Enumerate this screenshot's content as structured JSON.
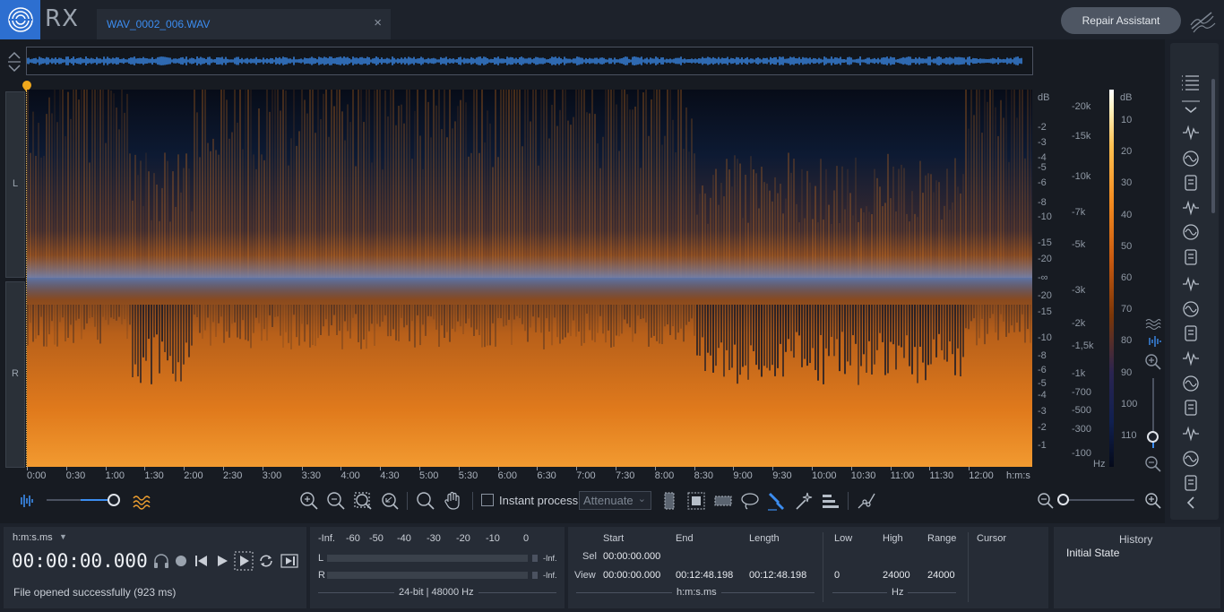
{
  "app": {
    "name": "RX"
  },
  "tab": {
    "file_name": "WAV_0002_006.WAV",
    "close_glyph": "×"
  },
  "header": {
    "repair_assistant_label": "Repair Assistant"
  },
  "channels": {
    "left_label": "L",
    "right_label": "R"
  },
  "db_axis": {
    "unit": "dB",
    "left_ticks": [
      "-2",
      "-3",
      "-4",
      "-5",
      "-6",
      "-8",
      "-10",
      "-15",
      "-20",
      "-∞",
      "-20",
      "-15",
      "-10",
      "-8",
      "-6",
      "-5",
      "-4",
      "-3",
      "-2",
      "-1"
    ],
    "hz_ticks": [
      "-20k",
      "-15k",
      "-10k",
      "-7k",
      "-5k",
      "-3k",
      "-2k",
      "-1,5k",
      "-1k",
      "-700",
      "-500",
      "-300",
      "-100"
    ],
    "hz_unit": "Hz",
    "colorbar_unit": "dB",
    "colorbar_ticks": [
      "10",
      "20",
      "30",
      "40",
      "50",
      "60",
      "70",
      "80",
      "90",
      "100",
      "110"
    ]
  },
  "time_axis": {
    "ticks": [
      "0:00",
      "0:30",
      "1:00",
      "1:30",
      "2:00",
      "2:30",
      "3:00",
      "3:30",
      "4:00",
      "4:30",
      "5:00",
      "5:30",
      "6:00",
      "6:30",
      "7:00",
      "7:30",
      "8:00",
      "8:30",
      "9:00",
      "9:30",
      "10:00",
      "10:30",
      "11:00",
      "11:30",
      "12:00"
    ],
    "unit": "h:m:s"
  },
  "toolbar": {
    "instant_process_label": "Instant process",
    "instant_process_checked": false,
    "mode_select_value": "Attenuate"
  },
  "transport": {
    "time_format_label": "h:m:s.ms",
    "time_display": "00:00:00.000",
    "status_message": "File opened successfully (923 ms)"
  },
  "meter": {
    "scale": [
      "-Inf.",
      "-60",
      "-50",
      "-40",
      "-30",
      "-20",
      "-10",
      "0"
    ],
    "left_label": "L",
    "right_label": "R",
    "left_value": "-Inf.",
    "right_value": "-Inf.",
    "format": "24-bit | 48000 Hz"
  },
  "selection": {
    "headers": {
      "start": "Start",
      "end": "End",
      "length": "Length",
      "low": "Low",
      "high": "High",
      "range": "Range",
      "cursor": "Cursor"
    },
    "sel_label": "Sel",
    "view_label": "View",
    "sel_start": "00:00:00.000",
    "view_start": "00:00:00.000",
    "view_end": "00:12:48.198",
    "view_length": "00:12:48.198",
    "time_unit": "h:m:s.ms",
    "view_low": "0",
    "view_high": "24000",
    "view_range": "24000",
    "freq_unit": "Hz"
  },
  "history": {
    "title": "History",
    "items": [
      "Initial State"
    ]
  },
  "colors": {
    "accent": "#2d6fd0",
    "spectrum_hot": "#f28a1f",
    "background": "#171b22"
  }
}
